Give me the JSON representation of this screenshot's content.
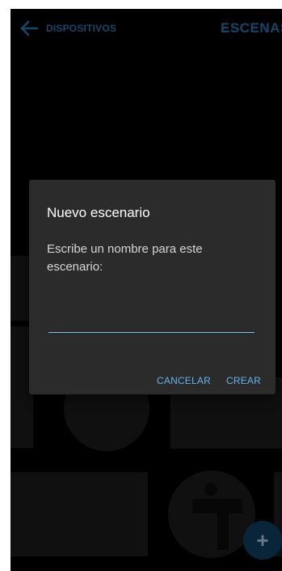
{
  "topbar": {
    "back_label": "DISPOSITIVOS",
    "tab_label": "ESCENAS"
  },
  "dialog": {
    "title": "Nuevo escenario",
    "message": "Escribe un nombre para este escenario:",
    "input_value": "",
    "input_placeholder": "",
    "cancel_label": "CANCELAR",
    "create_label": "CREAR"
  },
  "fab": {
    "icon": "plus-icon",
    "label": "+"
  },
  "colors": {
    "accent": "#5fb4ea",
    "nav_blue": "#1f6fa5",
    "dialog_bg": "#2b2b2b",
    "screen_bg": "#000000"
  }
}
